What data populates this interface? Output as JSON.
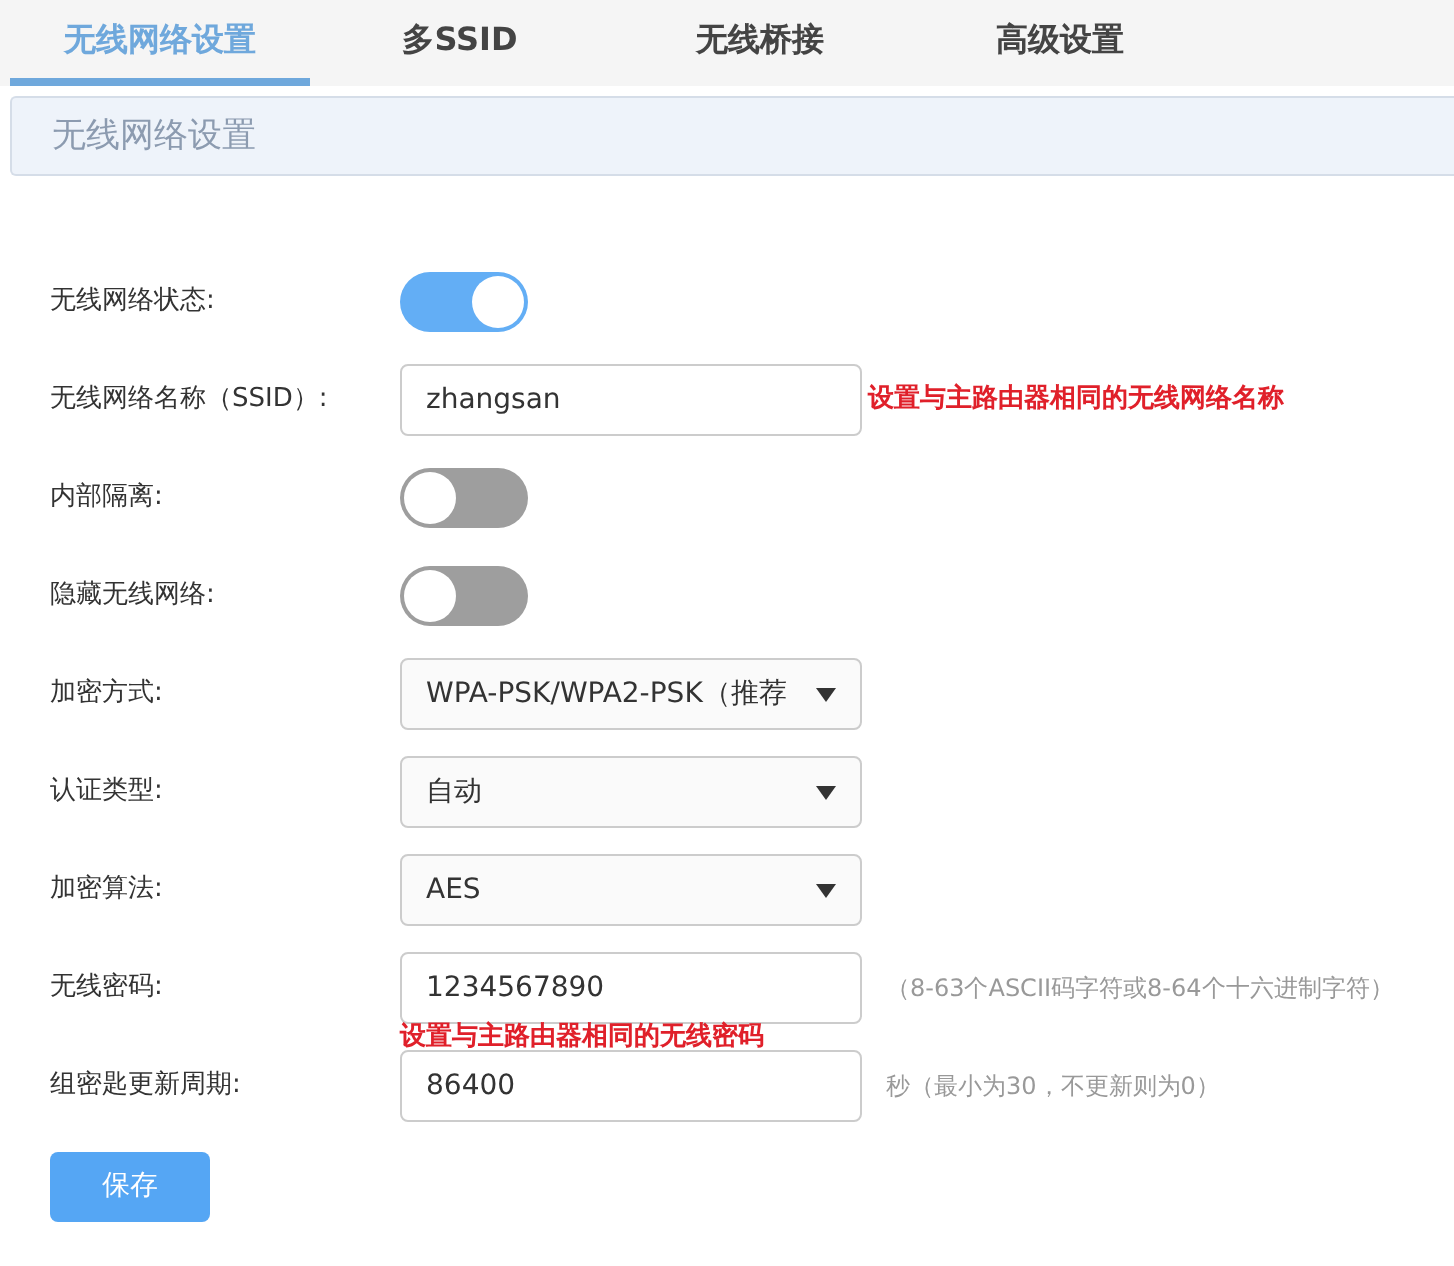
{
  "tabs": [
    {
      "label": "无线网络设置",
      "selected": true
    },
    {
      "label": "多SSID",
      "selected": false
    },
    {
      "label": "无线桥接",
      "selected": false
    },
    {
      "label": "高级设置",
      "selected": false
    }
  ],
  "section_title": "无线网络设置",
  "fields": [
    {
      "kind": "toggle",
      "label": "无线网络状态:",
      "on": true
    },
    {
      "kind": "text",
      "label": "无线网络名称（SSID）:",
      "value": "zhangsan",
      "annotation": "设置与主路由器相同的无线网络名称"
    },
    {
      "kind": "toggle",
      "label": "内部隔离:",
      "on": false
    },
    {
      "kind": "toggle",
      "label": "隐藏无线网络:",
      "on": false
    },
    {
      "kind": "select",
      "label": "加密方式:",
      "value": "WPA-PSK/WPA2-PSK（推荐"
    },
    {
      "kind": "select",
      "label": "认证类型:",
      "value": "自动"
    },
    {
      "kind": "select",
      "label": "加密算法:",
      "value": "AES"
    },
    {
      "kind": "text",
      "label": "无线密码:",
      "value": "1234567890",
      "note": "（8-63个ASCII码字符或8-64个十六进制字符）",
      "annotation_below": "设置与主路由器相同的无线密码"
    },
    {
      "kind": "text",
      "label": "组密匙更新周期:",
      "value": "86400",
      "note": "秒（最小为30，不更新则为0）"
    }
  ],
  "save_button": "保存"
}
